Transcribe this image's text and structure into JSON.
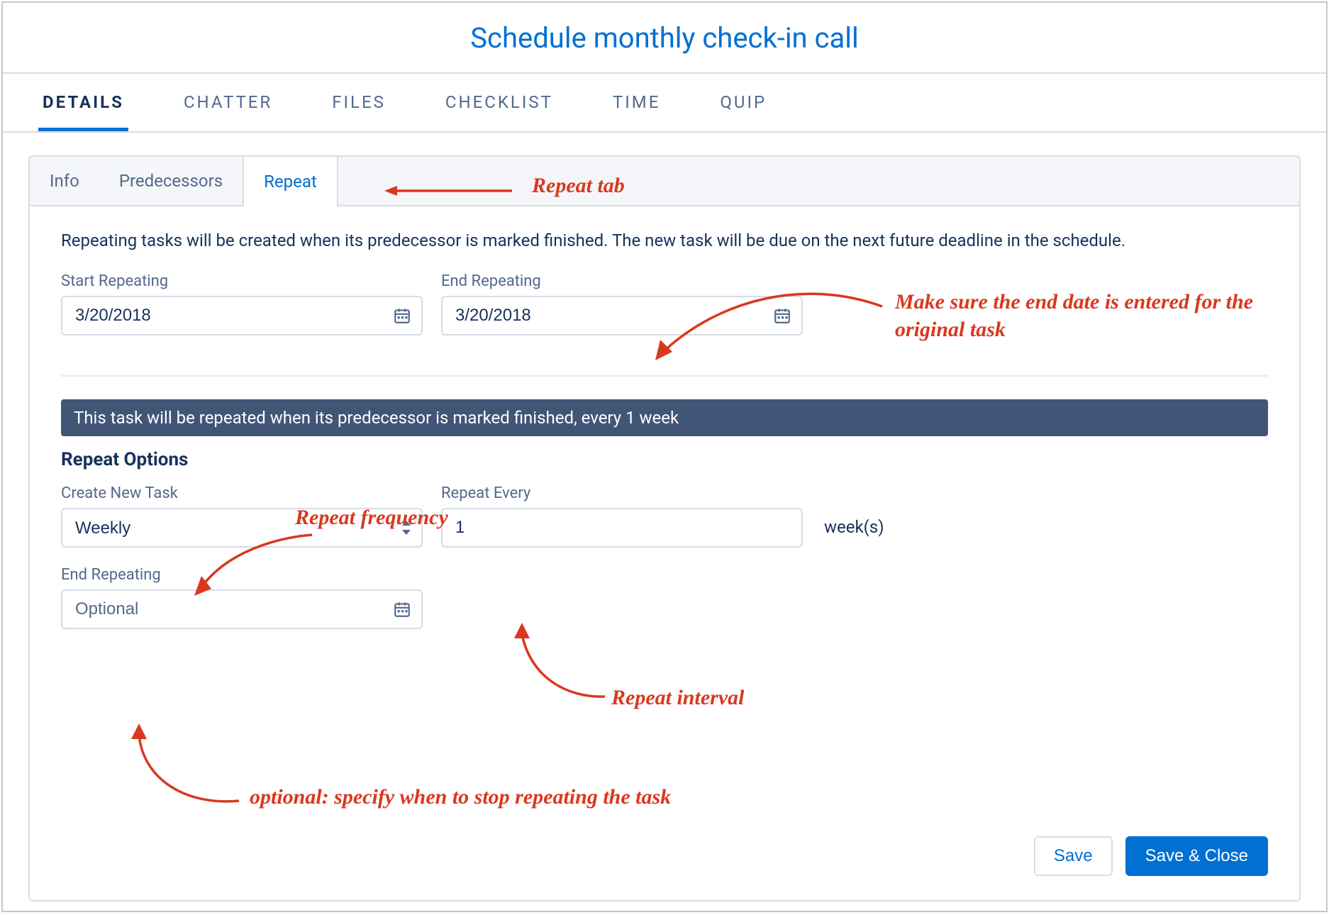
{
  "title": "Schedule monthly check-in call",
  "main_tabs": {
    "details": "DETAILS",
    "chatter": "CHATTER",
    "files": "FILES",
    "checklist": "CHECKLIST",
    "time": "TIME",
    "quip": "QUIP"
  },
  "sub_tabs": {
    "info": "Info",
    "predecessors": "Predecessors",
    "repeat": "Repeat"
  },
  "description": "Repeating tasks will be created when its predecessor is marked finished. The new task will be due on the next future deadline in the schedule.",
  "start_repeating": {
    "label": "Start Repeating",
    "value": "3/20/2018"
  },
  "end_repeating_top": {
    "label": "End Repeating",
    "value": "3/20/2018"
  },
  "banner": "This task will be repeated when its predecessor is marked finished, every 1 week",
  "repeat_options_title": "Repeat Options",
  "create_new_task": {
    "label": "Create New Task",
    "value": "Weekly"
  },
  "repeat_every": {
    "label": "Repeat Every",
    "value": "1",
    "units": "week(s)"
  },
  "end_repeating_bottom": {
    "label": "End Repeating",
    "placeholder": "Optional"
  },
  "buttons": {
    "save": "Save",
    "save_close": "Save & Close"
  },
  "annotations": {
    "repeat_tab": "Repeat tab",
    "end_date": "Make sure the end date is entered for the original task",
    "frequency": "Repeat frequency",
    "interval": "Repeat interval",
    "optional": "optional: specify when to stop repeating the task"
  }
}
